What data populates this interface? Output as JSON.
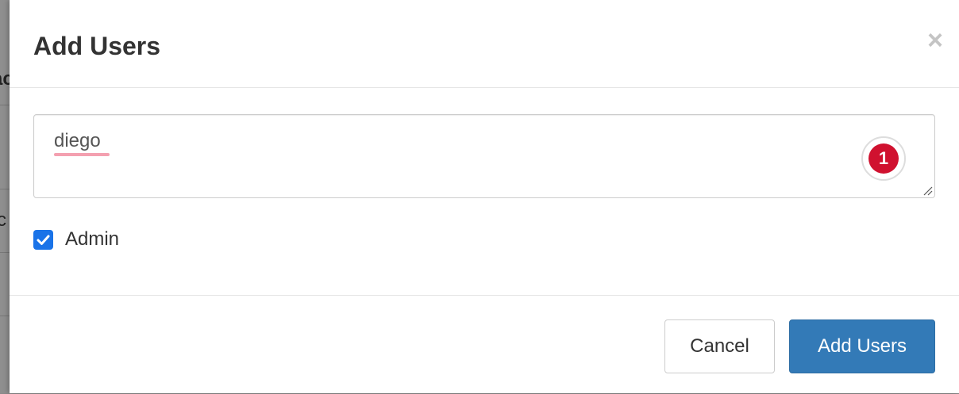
{
  "background": {
    "partial_text_1": "ac",
    "partial_text_2": "c"
  },
  "modal": {
    "title": "Add Users",
    "close_label": "×",
    "textarea": {
      "value": "diego"
    },
    "extension_badge": {
      "count": "1",
      "color": "#d0112f"
    },
    "admin_checkbox": {
      "label": "Admin",
      "checked": true,
      "color": "#1a73e8"
    },
    "footer": {
      "cancel_label": "Cancel",
      "submit_label": "Add Users",
      "primary_color": "#337ab7"
    }
  }
}
